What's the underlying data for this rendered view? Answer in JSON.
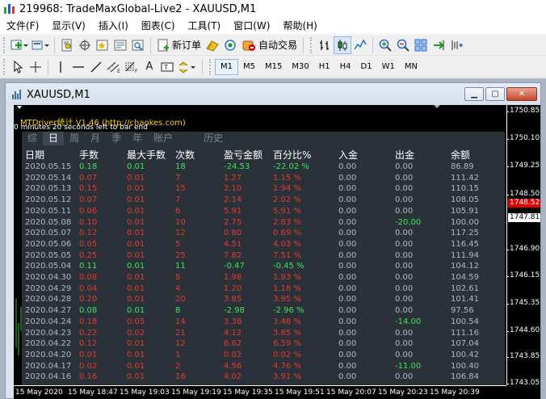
{
  "window": {
    "title": "219968: TradeMaxGlobal-Live2 - XAUUSD,M1"
  },
  "menu": [
    "文件(F)",
    "显示(V)",
    "插入(I)",
    "图表(C)",
    "工具(T)",
    "窗口(W)",
    "帮助(H)"
  ],
  "toolbar1": {
    "new_order_label": "新订单",
    "auto_trading_label": "自动交易"
  },
  "toolbar2": {
    "timeframes": [
      "M1",
      "M5",
      "M15",
      "M30",
      "H1",
      "H4",
      "D1",
      "W1",
      "MN"
    ],
    "active_timeframe": "M1"
  },
  "chart_window": {
    "title": "XAUUSD,M1"
  },
  "chart": {
    "ea_title": "MTDriver统计 V1.46  (http://chaokes.com)",
    "timer_text": "0 minutes 20 seconds left to bar end",
    "price_labels": [
      "1750.85",
      "1750.10",
      "1749.25",
      "1748.50",
      "1747.81",
      "1746.90",
      "1746.15",
      "1745.35",
      "1744.60",
      "1743.85",
      "1743.05"
    ],
    "bid_price": "1748.52",
    "ask_price": "1747.81",
    "time_labels": [
      "15 May 2020",
      "15 May 18:47",
      "15 May 19:03",
      "15 May 19:19",
      "15 May 19:35",
      "15 May 19:51",
      "15 May 20:07",
      "15 May 20:23",
      "15 May 20:39"
    ]
  },
  "panel": {
    "tabs": [
      "综",
      "日",
      "周",
      "月",
      "季",
      "年",
      "账户",
      "历史"
    ],
    "active_tab": "日",
    "columns": [
      "日期",
      "手数",
      "最大手数",
      "次数",
      "盈亏金额",
      "百分比%",
      "入金",
      "出金",
      "余额"
    ],
    "rows": [
      {
        "date": "2020.05.15",
        "lots": "0.18",
        "max_lots": "0.01",
        "count": "18",
        "pnl": "-24.53",
        "pct": "-22.02 %",
        "deposit": "0.00",
        "withdraw": "0.00",
        "balance": "86.89",
        "color": "green"
      },
      {
        "date": "2020.05.14",
        "lots": "0.07",
        "max_lots": "0.01",
        "count": "7",
        "pnl": "1.27",
        "pct": "1.15 %",
        "deposit": "0.00",
        "withdraw": "0.00",
        "balance": "111.42",
        "color": "red"
      },
      {
        "date": "2020.05.13",
        "lots": "0.15",
        "max_lots": "0.01",
        "count": "15",
        "pnl": "2.10",
        "pct": "1.94 %",
        "deposit": "0.00",
        "withdraw": "0.00",
        "balance": "110.15",
        "color": "red"
      },
      {
        "date": "2020.05.12",
        "lots": "0.07",
        "max_lots": "0.01",
        "count": "7",
        "pnl": "2.14",
        "pct": "2.02 %",
        "deposit": "0.00",
        "withdraw": "0.00",
        "balance": "108.05",
        "color": "red"
      },
      {
        "date": "2020.05.11",
        "lots": "0.06",
        "max_lots": "0.01",
        "count": "6",
        "pnl": "5.91",
        "pct": "5.91 %",
        "deposit": "0.00",
        "withdraw": "0.00",
        "balance": "105.91",
        "color": "red"
      },
      {
        "date": "2020.05.08",
        "lots": "0.10",
        "max_lots": "0.01",
        "count": "10",
        "pnl": "2.75",
        "pct": "2.83 %",
        "deposit": "0.00",
        "withdraw": "-20.00",
        "balance": "100.00",
        "color": "red"
      },
      {
        "date": "2020.05.07",
        "lots": "0.12",
        "max_lots": "0.01",
        "count": "12",
        "pnl": "0.80",
        "pct": "0.69 %",
        "deposit": "0.00",
        "withdraw": "0.00",
        "balance": "117.25",
        "color": "red"
      },
      {
        "date": "2020.05.06",
        "lots": "0.05",
        "max_lots": "0.01",
        "count": "5",
        "pnl": "4.51",
        "pct": "4.03 %",
        "deposit": "0.00",
        "withdraw": "0.00",
        "balance": "116.45",
        "color": "red"
      },
      {
        "date": "2020.05.05",
        "lots": "0.25",
        "max_lots": "0.01",
        "count": "25",
        "pnl": "7.82",
        "pct": "7.51 %",
        "deposit": "0.00",
        "withdraw": "0.00",
        "balance": "111.94",
        "color": "red"
      },
      {
        "date": "2020.05.04",
        "lots": "0.11",
        "max_lots": "0.01",
        "count": "11",
        "pnl": "-0.47",
        "pct": "-0.45 %",
        "deposit": "0.00",
        "withdraw": "0.00",
        "balance": "104.12",
        "color": "green"
      },
      {
        "date": "2020.04.30",
        "lots": "0.08",
        "max_lots": "0.01",
        "count": "8",
        "pnl": "1.98",
        "pct": "1.93 %",
        "deposit": "0.00",
        "withdraw": "0.00",
        "balance": "104.59",
        "color": "red"
      },
      {
        "date": "2020.04.29",
        "lots": "0.04",
        "max_lots": "0.01",
        "count": "4",
        "pnl": "1.20",
        "pct": "1.18 %",
        "deposit": "0.00",
        "withdraw": "0.00",
        "balance": "102.61",
        "color": "red"
      },
      {
        "date": "2020.04.28",
        "lots": "0.20",
        "max_lots": "0.01",
        "count": "20",
        "pnl": "3.85",
        "pct": "3.95 %",
        "deposit": "0.00",
        "withdraw": "0.00",
        "balance": "101.41",
        "color": "red"
      },
      {
        "date": "2020.04.27",
        "lots": "0.08",
        "max_lots": "0.01",
        "count": "8",
        "pnl": "-2.98",
        "pct": "-2.96 %",
        "deposit": "0.00",
        "withdraw": "0.00",
        "balance": "97.56",
        "color": "green"
      },
      {
        "date": "2020.04.24",
        "lots": "0.18",
        "max_lots": "0.05",
        "count": "14",
        "pnl": "3.38",
        "pct": "3.48 %",
        "deposit": "0.00",
        "withdraw": "-14.00",
        "balance": "100.54",
        "color": "red"
      },
      {
        "date": "2020.04.23",
        "lots": "0.22",
        "max_lots": "0.02",
        "count": "21",
        "pnl": "4.12",
        "pct": "3.85 %",
        "deposit": "0.00",
        "withdraw": "0.00",
        "balance": "111.16",
        "color": "red"
      },
      {
        "date": "2020.04.22",
        "lots": "0.12",
        "max_lots": "0.01",
        "count": "12",
        "pnl": "6.62",
        "pct": "6.59 %",
        "deposit": "0.00",
        "withdraw": "0.00",
        "balance": "107.04",
        "color": "red"
      },
      {
        "date": "2020.04.20",
        "lots": "0.01",
        "max_lots": "0.01",
        "count": "1",
        "pnl": "0.02",
        "pct": "0.02 %",
        "deposit": "0.00",
        "withdraw": "0.00",
        "balance": "100.42",
        "color": "red"
      },
      {
        "date": "2020.04.17",
        "lots": "0.02",
        "max_lots": "0.01",
        "count": "2",
        "pnl": "4.56",
        "pct": "4.76 %",
        "deposit": "0.00",
        "withdraw": "-11.00",
        "balance": "100.40",
        "color": "red"
      },
      {
        "date": "2020.04.16",
        "lots": "0.16",
        "max_lots": "0.01",
        "count": "16",
        "pnl": "4.02",
        "pct": "3.91 %",
        "deposit": "0.00",
        "withdraw": "0.00",
        "balance": "106.84",
        "color": "red"
      }
    ]
  },
  "colors": {
    "positive": "#e23a2c",
    "negative": "#3fe35a",
    "neutral": "#b4b9c0",
    "panel_bg": "#2b3139",
    "ea_title": "#ffd400"
  }
}
